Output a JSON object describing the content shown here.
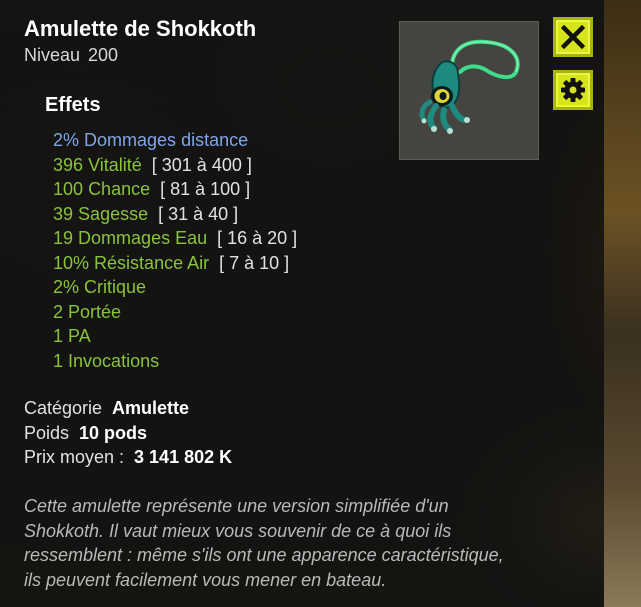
{
  "item": {
    "name": "Amulette de Shokkoth",
    "level_label": "Niveau",
    "level_value": "200",
    "icon": "squid-amulet-icon"
  },
  "effects": {
    "title": "Effets",
    "lines": [
      {
        "value": "2%",
        "label": "Dommages distance",
        "range": "",
        "negative": true
      },
      {
        "value": "396",
        "label": "Vitalité",
        "range": "[ 301 à 400 ]",
        "negative": false
      },
      {
        "value": "100",
        "label": "Chance",
        "range": "[ 81 à 100 ]",
        "negative": false
      },
      {
        "value": "39",
        "label": "Sagesse",
        "range": "[ 31 à 40 ]",
        "negative": false
      },
      {
        "value": "19",
        "label": "Dommages Eau",
        "range": "[ 16 à 20 ]",
        "negative": false
      },
      {
        "value": "10%",
        "label": "Résistance Air",
        "range": "[ 7 à 10 ]",
        "negative": false
      },
      {
        "value": "2%",
        "label": "Critique",
        "range": "",
        "negative": false
      },
      {
        "value": "2",
        "label": "Portée",
        "range": "",
        "negative": false
      },
      {
        "value": "1",
        "label": "PA",
        "range": "",
        "negative": false
      },
      {
        "value": "1",
        "label": "Invocations",
        "range": "",
        "negative": false
      }
    ]
  },
  "info": {
    "category_label": "Catégorie",
    "category_value": "Amulette",
    "weight_label": "Poids",
    "weight_value": "10 pods",
    "price_label": "Prix moyen :",
    "price_value": "3 141 802 K"
  },
  "description": "Cette amulette représente une version simplifiée d'un Shokkoth. Il vaut mieux vous souvenir de ce à quoi ils ressemblent : même s'ils ont une apparence caractéristique, ils peuvent facilement vous mener en bateau.",
  "buttons": {
    "close_icon": "close-icon",
    "settings_icon": "gear-icon"
  },
  "colors": {
    "positive_effect": "#89c43a",
    "negative_effect": "#7fa6e6",
    "button_bg": "#d6e51b",
    "panel_bg": "#121210"
  }
}
